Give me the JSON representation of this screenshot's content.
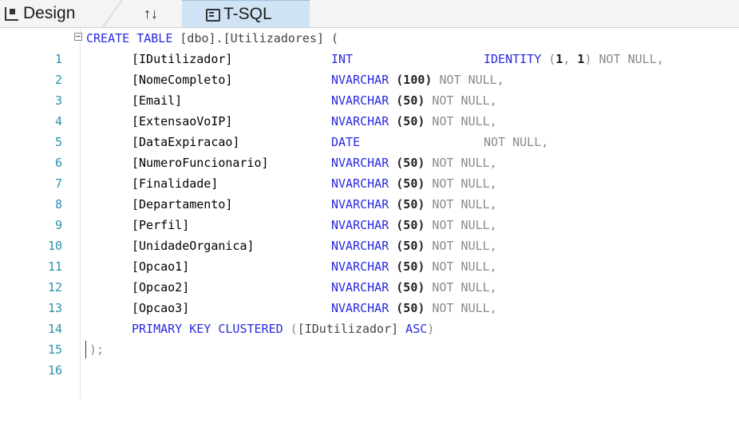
{
  "tabs": [
    {
      "label": "Design",
      "icon": "design-icon"
    },
    {
      "label": "↑↓",
      "icon": "swap-pane-icon"
    },
    {
      "label": "T-SQL",
      "icon": "database-icon"
    }
  ],
  "active_tab": "T-SQL",
  "editor": {
    "line_numbers": [
      "1",
      "2",
      "3",
      "4",
      "5",
      "6",
      "7",
      "8",
      "9",
      "10",
      "11",
      "12",
      "13",
      "14",
      "15",
      "16"
    ],
    "header": {
      "kw": "CREATE TABLE",
      "name": " [dbo].[Utilizadores] ("
    },
    "columns": [
      {
        "name": "[IDutilizador]",
        "type": "INT",
        "size": "",
        "nn": "",
        "identity": "IDENTITY",
        "id_open": " (",
        "id_seed": "1",
        "id_sep": ", ",
        "id_inc": "1",
        "id_close": ")",
        "id_nn": " NOT NULL,"
      },
      {
        "name": "[NomeCompleto]",
        "type": "NVARCHAR",
        "size": " (100)",
        "nn": " NOT NULL,"
      },
      {
        "name": "[Email]",
        "type": "NVARCHAR",
        "size": " (50)",
        "nn": " NOT NULL,"
      },
      {
        "name": "[ExtensaoVoIP]",
        "type": "NVARCHAR",
        "size": " (50)",
        "nn": " NOT NULL,"
      },
      {
        "name": "[DataExpiracao]",
        "type": "DATE",
        "size": "",
        "nn": "NOT NULL,"
      },
      {
        "name": "[NumeroFuncionario]",
        "type": "NVARCHAR",
        "size": " (50)",
        "nn": " NOT NULL,"
      },
      {
        "name": "[Finalidade]",
        "type": "NVARCHAR",
        "size": " (50)",
        "nn": " NOT NULL,"
      },
      {
        "name": "[Departamento]",
        "type": "NVARCHAR",
        "size": " (50)",
        "nn": " NOT NULL,"
      },
      {
        "name": "[Perfil]",
        "type": "NVARCHAR",
        "size": " (50)",
        "nn": " NOT NULL,"
      },
      {
        "name": "[UnidadeOrganica]",
        "type": "NVARCHAR",
        "size": " (50)",
        "nn": " NOT NULL,"
      },
      {
        "name": "[Opcao1]",
        "type": "NVARCHAR",
        "size": " (50)",
        "nn": " NOT NULL,"
      },
      {
        "name": "[Opcao2]",
        "type": "NVARCHAR",
        "size": " (50)",
        "nn": " NOT NULL,"
      },
      {
        "name": "[Opcao3]",
        "type": "NVARCHAR",
        "size": " (50)",
        "nn": " NOT NULL,"
      }
    ],
    "pk": {
      "kw": "PRIMARY KEY CLUSTERED",
      "open": " (",
      "col": "[IDutilizador]",
      "asc": " ASC",
      "close": ")"
    },
    "footer": ");"
  },
  "colors": {
    "keyword": "#2a2ae0",
    "line_number": "#2b91af",
    "gray": "#8a8a8a",
    "active_tab": "#cfe3f4"
  }
}
